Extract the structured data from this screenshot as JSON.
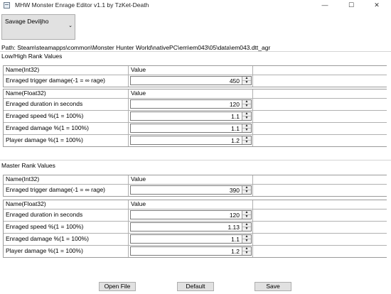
{
  "window": {
    "title": "MHW Monster Enrage Editor v1.1 by TzKet-Death",
    "minimize": "—",
    "maximize": "☐",
    "close": "✕"
  },
  "monster_select": {
    "value": "Savage Deviljho"
  },
  "path": "Path: Steam\\steamapps\\common\\Monster Hunter World\\nativePC\\em\\em043\\05\\data\\em043.dtt_agr",
  "low_high": {
    "title": "Low/High Rank Values",
    "int_header": {
      "name": "Name(Int32)",
      "value": "Value"
    },
    "int_rows": [
      {
        "name": "Enraged trigger damage(-1 = ∞ rage)",
        "value": "450"
      }
    ],
    "float_header": {
      "name": "Name(Float32)",
      "value": "Value"
    },
    "float_rows": [
      {
        "name": "Enraged duration in seconds",
        "value": "120"
      },
      {
        "name": "Enraged speed %(1 = 100%)",
        "value": "1.1"
      },
      {
        "name": "Enraged damage %(1 = 100%)",
        "value": "1.1"
      },
      {
        "name": "Player damage %(1 = 100%)",
        "value": "1.2"
      }
    ]
  },
  "master": {
    "title": "Master Rank Values",
    "int_header": {
      "name": "Name(Int32)",
      "value": "Value"
    },
    "int_rows": [
      {
        "name": "Enraged trigger damage(-1 = ∞ rage)",
        "value": "390"
      }
    ],
    "float_header": {
      "name": "Name(Float32)",
      "value": "Value"
    },
    "float_rows": [
      {
        "name": "Enraged duration in seconds",
        "value": "120"
      },
      {
        "name": "Enraged speed %(1 = 100%)",
        "value": "1.13"
      },
      {
        "name": "Enraged damage %(1 = 100%)",
        "value": "1.1"
      },
      {
        "name": "Player damage %(1 = 100%)",
        "value": "1.2"
      }
    ]
  },
  "buttons": {
    "open_file": "Open File",
    "default": "Default",
    "save": "Save"
  },
  "icons": {
    "spin_up": "▲",
    "spin_down": "▼",
    "dropdown": "⌄"
  }
}
